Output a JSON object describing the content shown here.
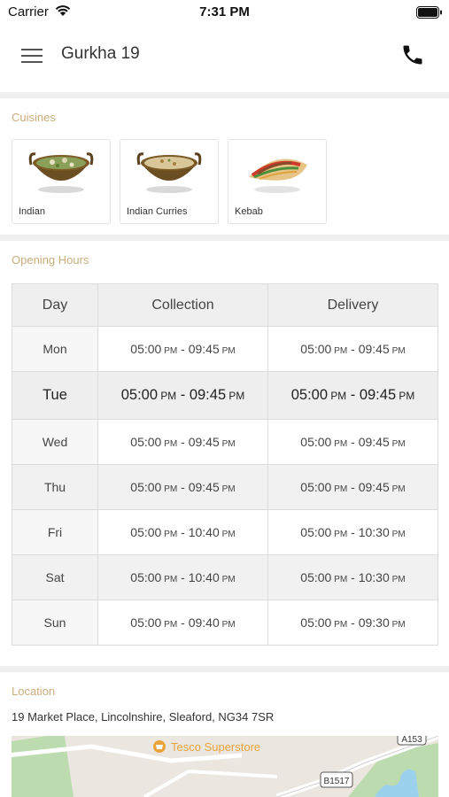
{
  "status_bar": {
    "carrier": "Carrier",
    "time": "7:31 PM"
  },
  "navbar": {
    "title": "Gurkha 19",
    "menu_icon": "hamburger-menu-icon",
    "call_icon": "phone-icon"
  },
  "cuisines": {
    "label": "Cuisines",
    "items": [
      {
        "name": "Indian",
        "image": "curry-bowl"
      },
      {
        "name": "Indian Curries",
        "image": "curry-bowl-cream"
      },
      {
        "name": "Kebab",
        "image": "kebab-wrap"
      }
    ]
  },
  "opening_hours": {
    "label": "Opening Hours",
    "columns": [
      "Day",
      "Collection",
      "Delivery"
    ],
    "rows": [
      {
        "day": "Mon",
        "collection": {
          "from": "05:00",
          "to": "09:45"
        },
        "delivery": {
          "from": "05:00",
          "to": "09:45"
        }
      },
      {
        "day": "Tue",
        "collection": {
          "from": "05:00",
          "to": "09:45"
        },
        "delivery": {
          "from": "05:00",
          "to": "09:45"
        }
      },
      {
        "day": "Wed",
        "collection": {
          "from": "05:00",
          "to": "09:45"
        },
        "delivery": {
          "from": "05:00",
          "to": "09:45"
        }
      },
      {
        "day": "Thu",
        "collection": {
          "from": "05:00",
          "to": "09:45"
        },
        "delivery": {
          "from": "05:00",
          "to": "09:45"
        }
      },
      {
        "day": "Fri",
        "collection": {
          "from": "05:00",
          "to": "10:40"
        },
        "delivery": {
          "from": "05:00",
          "to": "10:30"
        }
      },
      {
        "day": "Sat",
        "collection": {
          "from": "05:00",
          "to": "10:40"
        },
        "delivery": {
          "from": "05:00",
          "to": "10:30"
        }
      },
      {
        "day": "Sun",
        "collection": {
          "from": "05:00",
          "to": "09:40"
        },
        "delivery": {
          "from": "05:00",
          "to": "09:30"
        }
      }
    ],
    "ampm": "PM",
    "separator": " - "
  },
  "location": {
    "label": "Location",
    "address": "19 Market Place, Lincolnshire, Sleaford, NG34 7SR",
    "map": {
      "poi": "Tesco Superstore",
      "road_labels": [
        "A153",
        "B1517"
      ],
      "colors": {
        "poi": "#e8a33d",
        "water": "#9cd1ee",
        "park": "#bcdcb0",
        "road": "#ffffff"
      }
    }
  },
  "colors": {
    "section_label": "#c9ad7c",
    "divider": "#efefef"
  }
}
